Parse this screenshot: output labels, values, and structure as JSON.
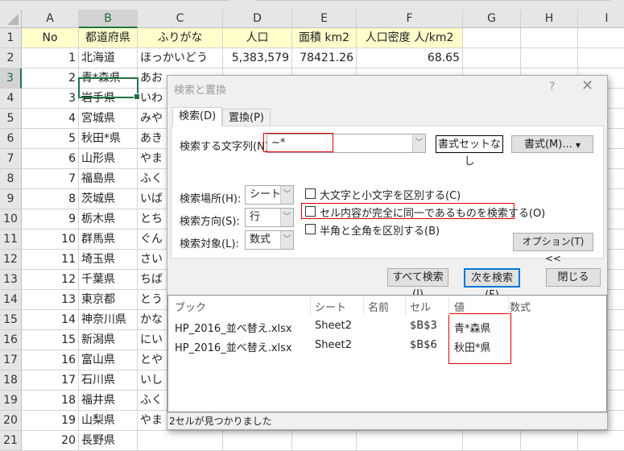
{
  "columns": [
    "A",
    "B",
    "C",
    "D",
    "E",
    "F",
    "G",
    "H",
    "I"
  ],
  "header_row": [
    "No",
    "都道府県",
    "ふりがな",
    "人口",
    "面積 km2",
    "人口密度 人/km2"
  ],
  "rows": [
    [
      "1",
      "北海道",
      "ほっかいどう",
      "5,383,579",
      "78421.26",
      "68.65"
    ],
    [
      "2",
      "青*森県",
      "あお",
      "",
      "",
      ""
    ],
    [
      "3",
      "岩手県",
      "いわ",
      "",
      "",
      ""
    ],
    [
      "4",
      "宮城県",
      "みや",
      "",
      "",
      ""
    ],
    [
      "5",
      "秋田*県",
      "あき",
      "",
      "",
      ""
    ],
    [
      "6",
      "山形県",
      "やま",
      "",
      "",
      ""
    ],
    [
      "7",
      "福島県",
      "ふく",
      "",
      "",
      ""
    ],
    [
      "8",
      "茨城県",
      "いば",
      "",
      "",
      ""
    ],
    [
      "9",
      "栃木県",
      "とち",
      "",
      "",
      ""
    ],
    [
      "10",
      "群馬県",
      "ぐん",
      "",
      "",
      ""
    ],
    [
      "11",
      "埼玉県",
      "さい",
      "",
      "",
      ""
    ],
    [
      "12",
      "千葉県",
      "ちば",
      "",
      "",
      ""
    ],
    [
      "13",
      "東京都",
      "とう",
      "",
      "",
      ""
    ],
    [
      "14",
      "神奈川県",
      "かな",
      "",
      "",
      ""
    ],
    [
      "15",
      "新潟県",
      "にい",
      "",
      "",
      ""
    ],
    [
      "16",
      "富山県",
      "とや",
      "",
      "",
      ""
    ],
    [
      "17",
      "石川県",
      "いし",
      "",
      "",
      ""
    ],
    [
      "18",
      "福井県",
      "ふく",
      "",
      "",
      ""
    ],
    [
      "19",
      "山梨県",
      "やま",
      "",
      "",
      ""
    ],
    [
      "20",
      "長野県",
      "",
      "",
      "",
      ""
    ]
  ],
  "dialog": {
    "title": "検索と置換",
    "help": "?",
    "close": "✕",
    "tabs": [
      "検索(D)",
      "置換(P)"
    ],
    "find_label": "検索する文字列(N):",
    "find_value": "~*",
    "no_format_button": "書式セットなし",
    "format_button": "書式(M)...",
    "within_label": "検索場所(H):",
    "within_value": "シート",
    "search_label": "検索方向(S):",
    "search_value": "行",
    "lookin_label": "検索対象(L):",
    "lookin_value": "数式",
    "checkboxes": [
      "大文字と小文字を区別する(C)",
      "セル内容が完全に同一であるものを検索する(O)",
      "半角と全角を区別する(B)"
    ],
    "options_button": "オプション(T) <<",
    "find_all": "すべて検索(I)",
    "find_next": "次を検索(F)",
    "close_button": "閉じる",
    "result_headers": [
      "ブック",
      "シート",
      "名前",
      "セル",
      "値",
      "数式"
    ],
    "results": [
      [
        "HP_2016_並べ替え.xlsx",
        "Sheet2",
        "",
        "$B$3",
        "青*森県",
        ""
      ],
      [
        "HP_2016_並べ替え.xlsx",
        "Sheet2",
        "",
        "$B$6",
        "秋田*県",
        ""
      ]
    ],
    "status": "2セルが見つかりました"
  }
}
